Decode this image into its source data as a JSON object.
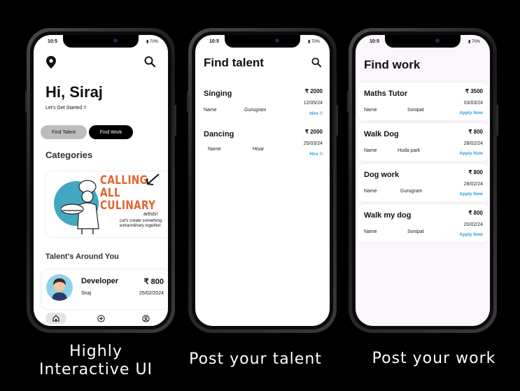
{
  "phone1": {
    "status_time": "10:5",
    "status_battery": "70%",
    "greeting": "Hi, Siraj",
    "subtitle": "Let's Get Started !!",
    "tabs": [
      "Find Talent",
      "Find Work"
    ],
    "categories_title": "Categories",
    "banner": {
      "line1": "CALLING",
      "line2": "ALL",
      "line3": "CULINARY",
      "line4": "artists!",
      "tagline": "Let's create something extraordinary together."
    },
    "talent_title": "Talent's Around You",
    "talent_card": {
      "role": "Developer",
      "price": "₹ 800",
      "name": "Siraj",
      "date": "25/02/2024"
    },
    "nav_icons": [
      "home-icon",
      "add-circle-icon",
      "profile-icon"
    ]
  },
  "phone2": {
    "status_time": "10:5",
    "status_battery": "70%",
    "title": "Find talent",
    "cards": [
      {
        "title": "Singing",
        "price": "₹ 2000",
        "label": "Name",
        "location": "Gurugram",
        "date": "12/05/24",
        "action": "Hire !!"
      },
      {
        "title": "Dancing",
        "price": "₹ 2000",
        "label": "Name",
        "location": "Hisar",
        "date": "25/03/24",
        "action": "Hire !!"
      }
    ]
  },
  "phone3": {
    "status_time": "10:5",
    "status_battery": "70%",
    "title": "Find work",
    "cards": [
      {
        "title": "Maths Tutor",
        "price": "₹ 3500",
        "label": "Name",
        "location": "Sonipat",
        "date": "03/03/24",
        "action": "Apply Now"
      },
      {
        "title": "Walk Dog",
        "price": "₹ 800",
        "label": "Name",
        "location": "Huda park",
        "date": "28/02/24",
        "action": "Apply Now"
      },
      {
        "title": "Dog work",
        "price": "₹ 800",
        "label": "Name",
        "location": "Gurugram",
        "date": "28/02/24",
        "action": "Apply Now"
      },
      {
        "title": "Walk my dog",
        "price": "₹ 800",
        "label": "Name",
        "location": "Sonipat",
        "date": "20/02/24",
        "action": "Apply Now"
      }
    ]
  },
  "captions": {
    "left_line1": "Highly",
    "left_line2": "Interactive UI",
    "middle": "Post your talent",
    "right": "Post your work"
  },
  "colors": {
    "accent_blue": "#2e9bdc",
    "banner_orange": "#e06530",
    "banner_teal": "#43a7c2"
  }
}
